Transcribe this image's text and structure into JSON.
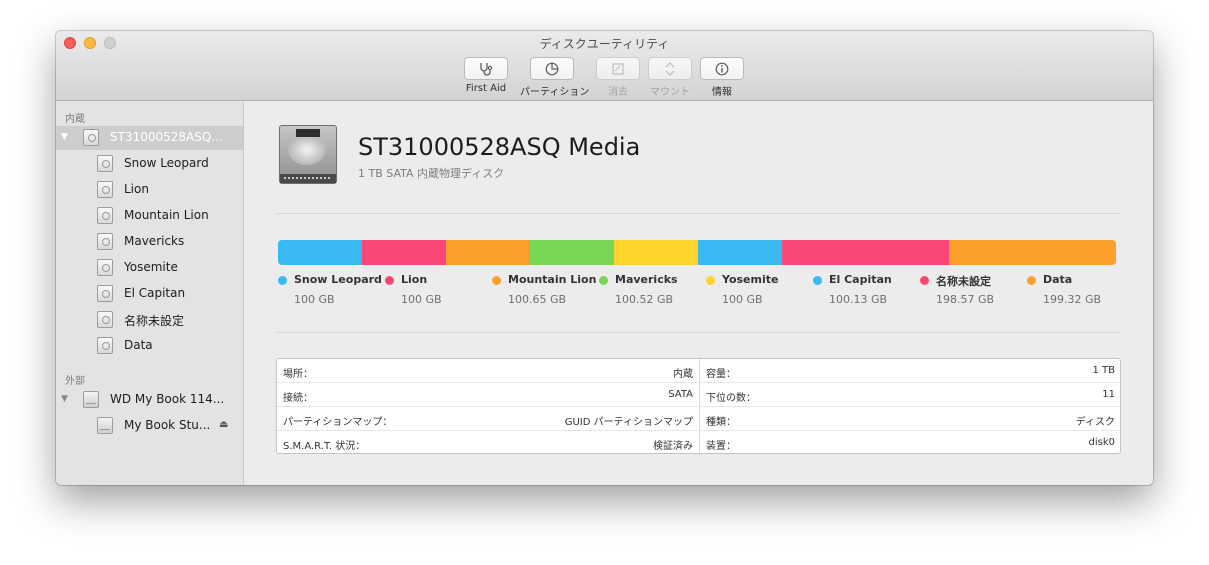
{
  "window": {
    "title": "ディスクユーティリティ"
  },
  "toolbar": [
    {
      "label": "First Aid",
      "icon": "stethoscope-icon",
      "enabled": true
    },
    {
      "label": "パーティション",
      "icon": "partition-icon",
      "enabled": true
    },
    {
      "label": "消去",
      "icon": "erase-icon",
      "enabled": false
    },
    {
      "label": "マウント",
      "icon": "mount-icon",
      "enabled": false
    },
    {
      "label": "情報",
      "icon": "info-icon",
      "enabled": true
    }
  ],
  "sidebar": {
    "internal_label": "内蔵",
    "internal_disk": "ST31000528ASQ...",
    "volumes": [
      "Snow Leopard",
      "Lion",
      "Mountain Lion",
      "Mavericks",
      "Yosemite",
      "El Capitan",
      "名称未設定",
      "Data"
    ],
    "external_label": "外部",
    "external_disk": "WD My Book 114...",
    "external_volume": "My Book Stu..."
  },
  "disk": {
    "name": "ST31000528ASQ Media",
    "subtitle": "1 TB SATA 内蔵物理ディスク"
  },
  "partitions": [
    {
      "name": "Snow Leopard",
      "size": "100 GB",
      "gb": 100,
      "color": "#38b9f2"
    },
    {
      "name": "Lion",
      "size": "100 GB",
      "gb": 100,
      "color": "#fb4778"
    },
    {
      "name": "Mountain Lion",
      "size": "100.65 GB",
      "gb": 100.65,
      "color": "#fc9f2b"
    },
    {
      "name": "Mavericks",
      "size": "100.52 GB",
      "gb": 100.52,
      "color": "#79d657"
    },
    {
      "name": "Yosemite",
      "size": "100 GB",
      "gb": 100,
      "color": "#fdd32c"
    },
    {
      "name": "El Capitan",
      "size": "100.13 GB",
      "gb": 100.13,
      "color": "#38b9f2"
    },
    {
      "name": "名称未設定",
      "size": "198.57 GB",
      "gb": 198.57,
      "color": "#fb4778"
    },
    {
      "name": "Data",
      "size": "199.32 GB",
      "gb": 199.32,
      "color": "#fc9f2b"
    }
  ],
  "info_left": [
    {
      "key": "場所：",
      "value": "内蔵"
    },
    {
      "key": "接続：",
      "value": "SATA"
    },
    {
      "key": "パーティションマップ：",
      "value": "GUID パーティションマップ"
    },
    {
      "key": "S.M.A.R.T. 状況：",
      "value": "検証済み"
    }
  ],
  "info_right": [
    {
      "key": "容量：",
      "value": "1 TB"
    },
    {
      "key": "下位の数：",
      "value": "11"
    },
    {
      "key": "種類：",
      "value": "ディスク"
    },
    {
      "key": "装置：",
      "value": "disk0"
    }
  ]
}
